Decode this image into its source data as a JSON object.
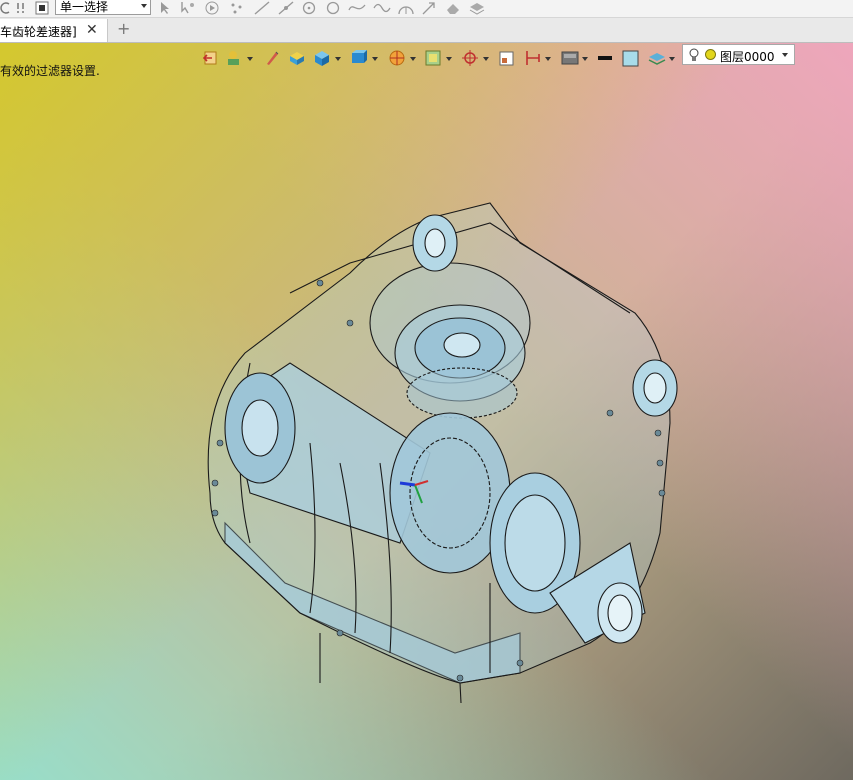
{
  "toolbar": {
    "icons": [
      "undo-icon",
      "redo-icon",
      "stop-icon",
      "pick-arrow-icon",
      "pick-points-icon",
      "pick-play-icon",
      "point-icon",
      "line-icon",
      "line-tool-icon",
      "circle-icon",
      "circle-ring-icon",
      "spline-icon",
      "wave-icon",
      "arc-icon",
      "arrow-icon",
      "eraser-icon",
      "feature-icon"
    ],
    "selection_filter": {
      "value": "单一选择"
    }
  },
  "tabs": [
    {
      "label": "车齿轮差速器]",
      "close": "✕"
    }
  ],
  "new_tab": "+",
  "viewport": {
    "status_text": "有效的过滤器设置.",
    "background_colors": {
      "top_left": "#d4c82e",
      "top_right": "#eea6bc",
      "bottom_left": "#98deca",
      "bottom_right": "#6e695f"
    },
    "model_color": "#a9cfe0",
    "view_toolbar_icons": [
      "exit-sketch-icon",
      "styles-icon",
      "paint-icon",
      "shading-icon",
      "cube-view-icon",
      "display-mode-icon",
      "orient-icon",
      "section-icon",
      "visibility-icon",
      "filter-icon",
      "ruler-icon",
      "background-icon",
      "line-color-icon",
      "fill-color-icon",
      "layers-icon"
    ],
    "layer": {
      "name": "图层0000"
    }
  }
}
